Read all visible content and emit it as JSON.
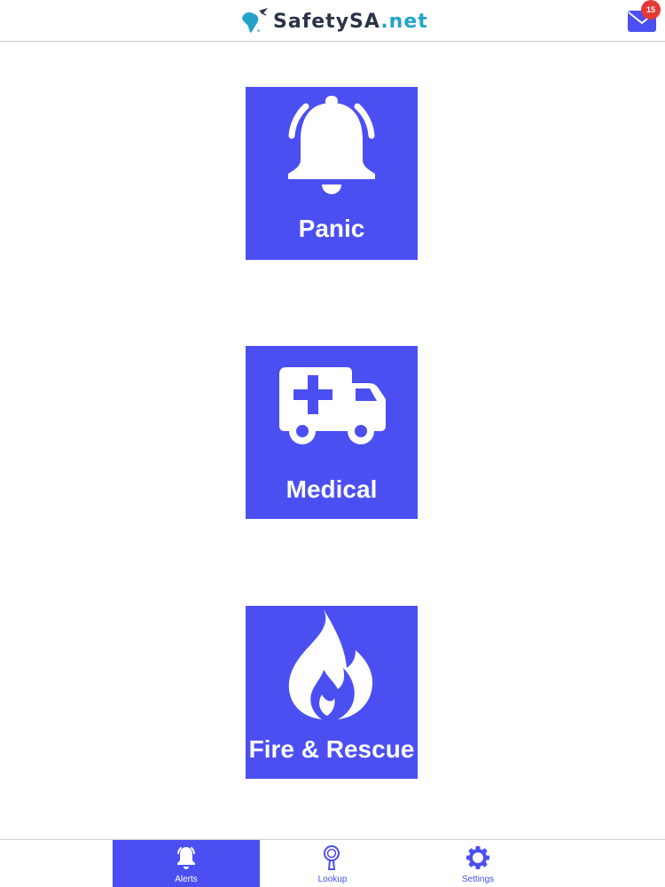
{
  "header": {
    "logo_name": "SafetySA",
    "logo_suffix": ".net",
    "inbox_icon": "envelope-icon",
    "inbox_count": "15"
  },
  "tiles": [
    {
      "id": "panic",
      "label": "Panic",
      "icon": "bell-icon"
    },
    {
      "id": "medical",
      "label": "Medical",
      "icon": "ambulance-icon"
    },
    {
      "id": "fire",
      "label": "Fire & Rescue",
      "icon": "fire-icon"
    }
  ],
  "nav": {
    "items": [
      {
        "label": "Alerts",
        "icon": "bell-icon",
        "active": true
      },
      {
        "label": "Lookup",
        "icon": "magnifier-icon",
        "active": false
      },
      {
        "label": "Settings",
        "icon": "gear-icon",
        "active": false
      }
    ]
  },
  "colors": {
    "accent": "#4b4ff2",
    "badge": "#e53935",
    "logo_text": "#2b3347",
    "logo_suffix": "#23a3c9"
  }
}
